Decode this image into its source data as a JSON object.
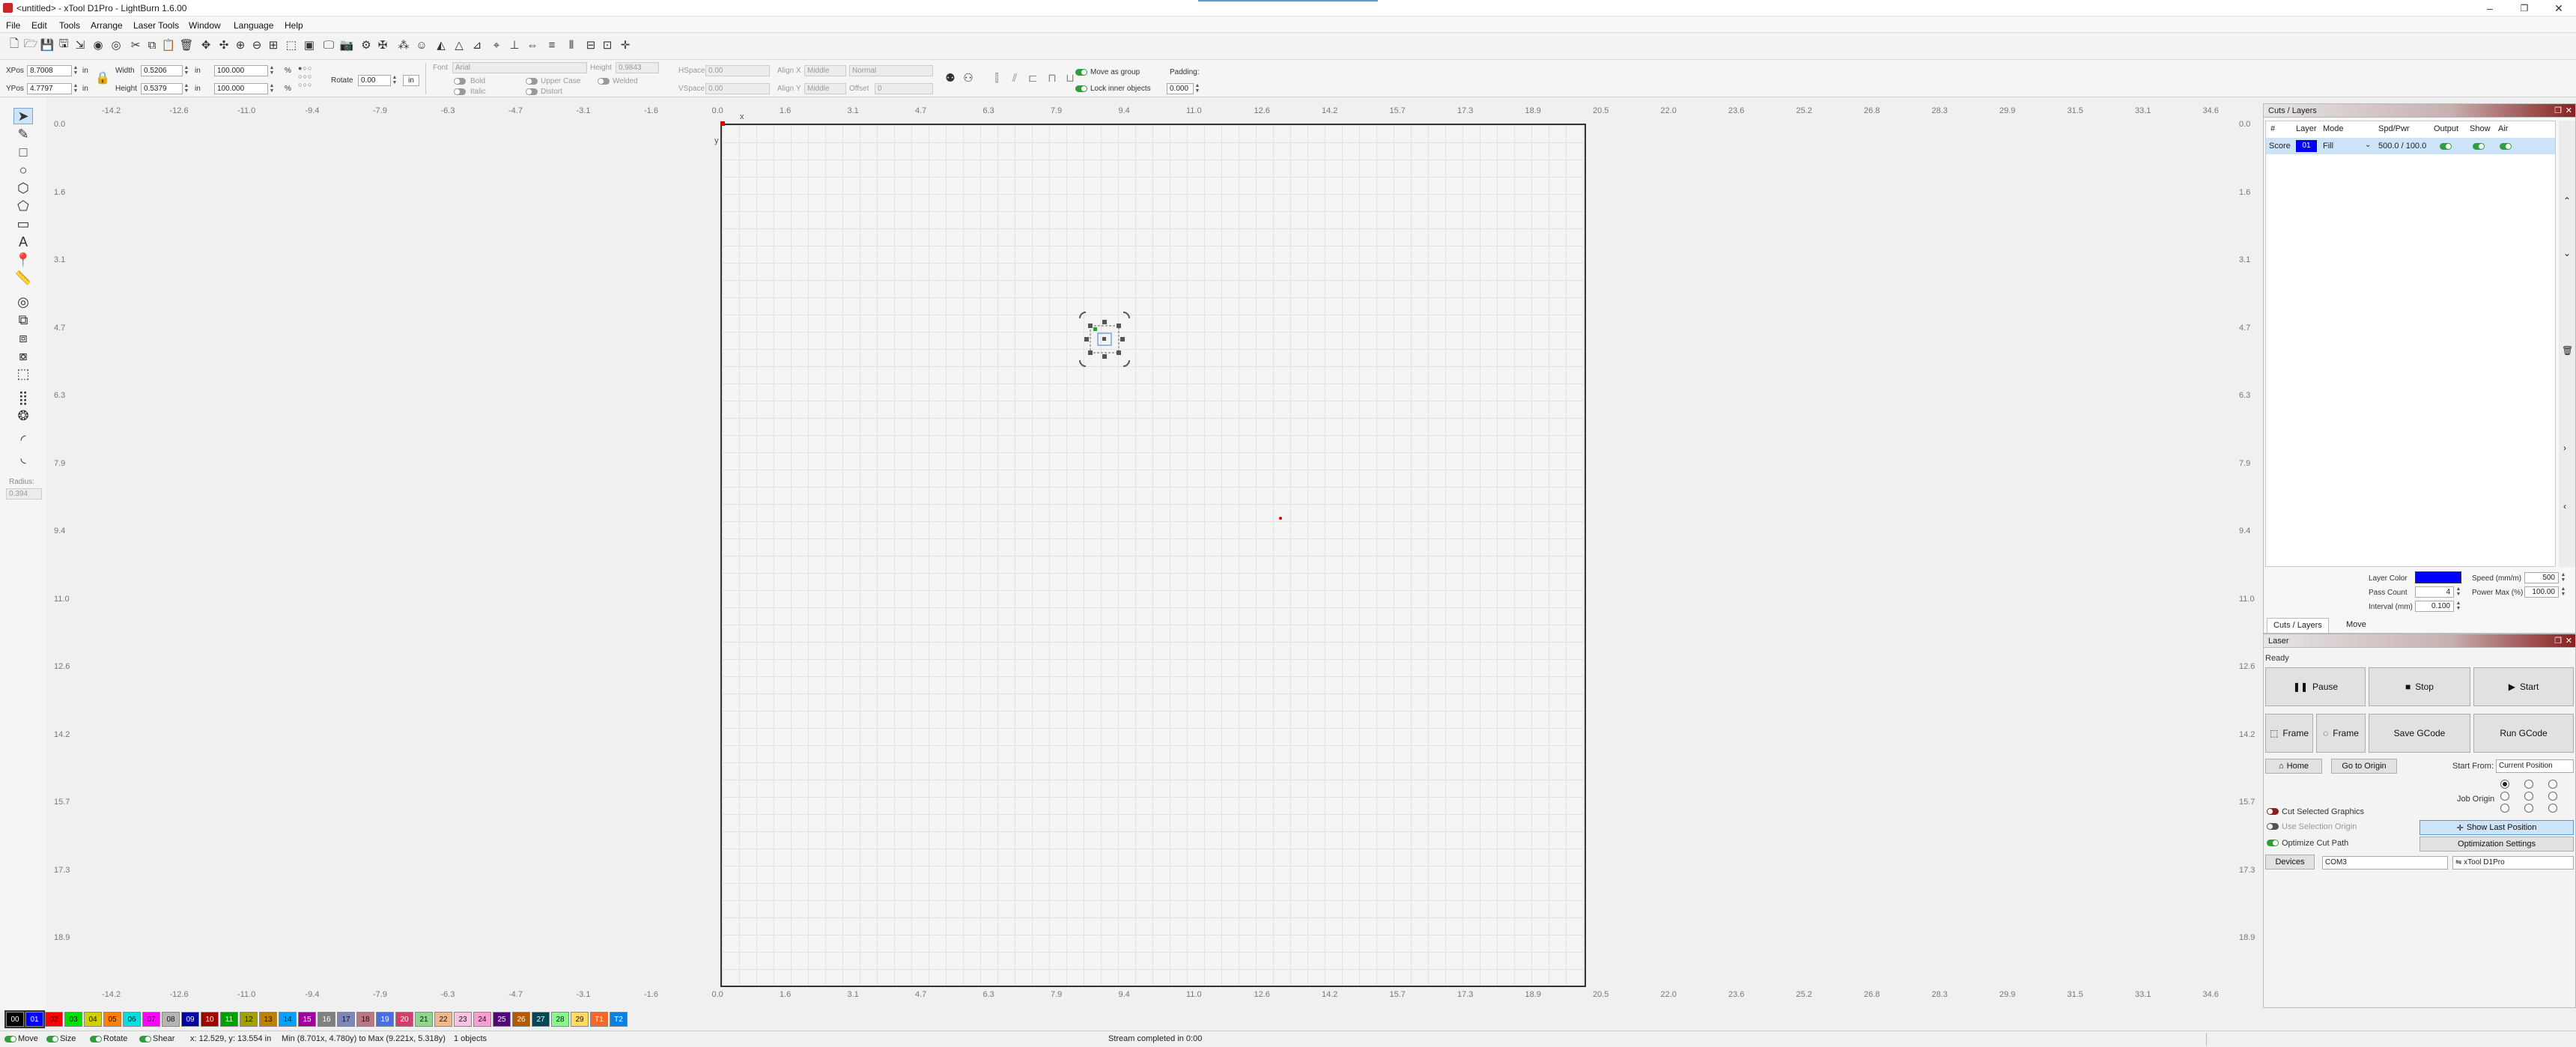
{
  "window": {
    "title": "<untitled> - xTool D1Pro - LightBurn 1.6.00",
    "minimize": "–",
    "maximize": "❐",
    "close": "✕"
  },
  "menu": [
    "File",
    "Edit",
    "Tools",
    "Arrange",
    "Laser Tools",
    "Window",
    "Language",
    "Help"
  ],
  "props": {
    "xpos_label": "XPos",
    "xpos": "8.7008",
    "ypos_label": "YPos",
    "ypos": "4.7797",
    "unit": "in",
    "width_label": "Width",
    "width": "0.5206",
    "height_label": "Height",
    "height": "0.5379",
    "scale_w": "100.000",
    "scale_h": "100.000",
    "pct": "%",
    "rotate_label": "Rotate",
    "rotate": "0.00",
    "font_label": "Font",
    "font": "Arial",
    "text_height_label": "Height",
    "text_height": "0.9843",
    "hspace_label": "HSpace",
    "hspace": "0.00",
    "vspace_label": "VSpace",
    "vspace": "0.00",
    "alignx_label": "Align X",
    "alignx": "Middle",
    "aligny_label": "Align Y",
    "aligny": "Middle",
    "normal": "Normal",
    "offset_label": "Offset",
    "offset": "0",
    "bold": "Bold",
    "italic": "Italic",
    "upper_case": "Upper Case",
    "welded": "Welded",
    "distort": "Distort",
    "move_as_group": "Move as group",
    "lock_inner": "Lock inner objects",
    "padding_label": "Padding:",
    "padding": "0.000",
    "radius_label": "Radius:",
    "radius": "0.394"
  },
  "ruler": {
    "x_labels": [
      "-14.2",
      "-12.6",
      "-11.0",
      "-9.4",
      "-7.9",
      "-6.3",
      "-4.7",
      "-3.1",
      "-1.6",
      "0.0",
      "1.6",
      "3.1",
      "4.7",
      "6.3",
      "7.9",
      "9.4",
      "11.0",
      "12.6",
      "14.2",
      "15.7",
      "17.3",
      "18.9",
      "20.5",
      "22.0",
      "23.6",
      "25.2",
      "26.8",
      "28.3",
      "29.9",
      "31.5",
      "33.1",
      "34.6"
    ],
    "y_labels": [
      "0.0",
      "1.6",
      "3.1",
      "4.7",
      "6.3",
      "7.9",
      "9.4",
      "11.0",
      "12.6",
      "14.2",
      "15.7",
      "17.3",
      "18.9"
    ],
    "x_axis": "x",
    "y_axis": "y"
  },
  "palette": [
    "00",
    "01",
    "02",
    "03",
    "04",
    "05",
    "06",
    "07",
    "08",
    "09",
    "10",
    "11",
    "12",
    "13",
    "14",
    "15",
    "16",
    "17",
    "18",
    "19",
    "20",
    "21",
    "22",
    "23",
    "24",
    "25",
    "26",
    "27",
    "28",
    "29",
    "T1",
    "T2"
  ],
  "palette_colors": [
    "#000000",
    "#0000ff",
    "#ff0000",
    "#00e000",
    "#d0d000",
    "#ff8000",
    "#00e0e0",
    "#ff00ff",
    "#b4b4b4",
    "#0000a0",
    "#a00000",
    "#00a000",
    "#a0a000",
    "#c08000",
    "#00a0ff",
    "#a000a0",
    "#808080",
    "#7d87b9",
    "#bb7784",
    "#4a6fe3",
    "#d33f6a",
    "#8cd78c",
    "#f0b98d",
    "#f6c4e1",
    "#fa9ed4",
    "#500a78",
    "#b45a00",
    "#004754",
    "#86fa88",
    "#ffdb66",
    "#f36926",
    "#0c7fe2"
  ],
  "status": {
    "move": "Move",
    "size": "Size",
    "rotate": "Rotate",
    "shear": "Shear",
    "coords": "x: 12.529, y: 13.554 in",
    "range": "Min (8.701x, 4.780y) to Max (9.221x, 5.318y)",
    "objects": "1 objects",
    "stream": "Stream completed in 0:00"
  },
  "cuts": {
    "title": "Cuts / Layers",
    "headers": [
      "#",
      "Layer",
      "Mode",
      "Spd/Pwr",
      "Output",
      "Show",
      "Air"
    ],
    "row": {
      "name": "Score",
      "layer": "01",
      "mode": "Fill",
      "spdpwr": "500.0 / 100.0"
    },
    "layer_color_label": "Layer Color",
    "speed_label": "Speed (mm/m)",
    "speed": "500",
    "pass_count_label": "Pass Count",
    "pass_count": "4",
    "power_max_label": "Power Max (%)",
    "power_max": "100.00",
    "interval_label": "Interval (mm)",
    "interval": "0.100",
    "tab_cuts": "Cuts / Layers",
    "tab_move": "Move"
  },
  "laser": {
    "title": "Laser",
    "state": "Ready",
    "pause": "Pause",
    "stop": "Stop",
    "start": "Start",
    "frame1": "Frame",
    "frame2": "Frame",
    "save_gcode": "Save GCode",
    "run_gcode": "Run GCode",
    "home": "Home",
    "go_to_origin": "Go to Origin",
    "start_from_label": "Start From:",
    "start_from": "Current Position",
    "job_origin_label": "Job Origin",
    "cut_selected": "Cut Selected Graphics",
    "use_selection_origin": "Use Selection Origin",
    "optimize_cut_path": "Optimize Cut Path",
    "show_last_position": "Show Last Position",
    "optimization_settings": "Optimization Settings",
    "devices": "Devices",
    "port": "COM3",
    "device": "xTool D1Pro"
  },
  "colors": {
    "accent_blue": "#0000ff",
    "selected_blue": "#cde3f8"
  }
}
